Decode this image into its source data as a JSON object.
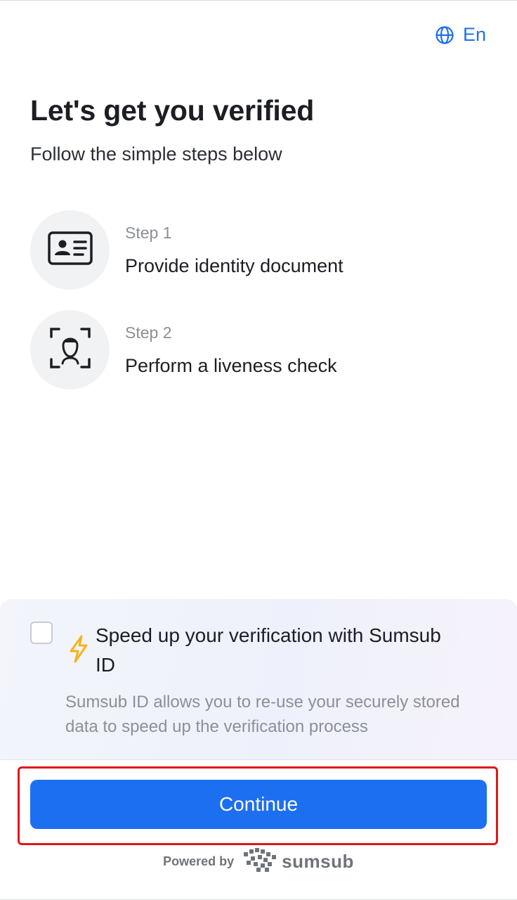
{
  "header": {
    "language_label": "En"
  },
  "main": {
    "title": "Let's get you verified",
    "subtitle": "Follow the simple steps below",
    "steps": [
      {
        "number_label": "Step 1",
        "label": "Provide identity document",
        "icon": "id-card-icon"
      },
      {
        "number_label": "Step 2",
        "label": "Perform a liveness check",
        "icon": "face-scan-icon"
      }
    ]
  },
  "promo": {
    "checked": false,
    "title": "Speed up your verification with Sumsub ID",
    "description": "Sumsub ID allows you to re-use your securely stored data to speed up the verification process",
    "icon": "lightning-icon"
  },
  "footer": {
    "continue_label": "Continue",
    "powered_by": "Powered by",
    "brand_name": "sumsub"
  },
  "colors": {
    "accent": "#1d6ff2",
    "highlight_border": "#e0161b",
    "bolt": "#f5b418"
  }
}
